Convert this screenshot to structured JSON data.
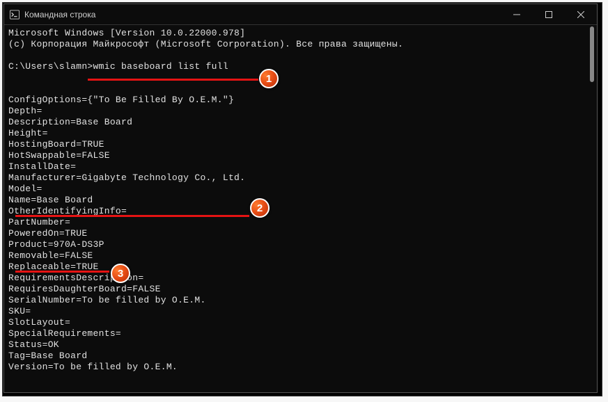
{
  "window": {
    "title": "Командная строка"
  },
  "terminal": {
    "banner_line1": "Microsoft Windows [Version 10.0.22000.978]",
    "banner_line2": "(c) Корпорация Майкрософт (Microsoft Corporation). Все права защищены.",
    "prompt": "C:\\Users\\slamn>",
    "command": "wmic baseboard list full",
    "output": {
      "ConfigOptions": "ConfigOptions={\"To Be Filled By O.E.M.\"}",
      "Depth": "Depth=",
      "Description": "Description=Base Board",
      "Height": "Height=",
      "HostingBoard": "HostingBoard=TRUE",
      "HotSwappable": "HotSwappable=FALSE",
      "InstallDate": "InstallDate=",
      "Manufacturer": "Manufacturer=Gigabyte Technology Co., Ltd.",
      "Model": "Model=",
      "Name": "Name=Base Board",
      "OtherIdentifyingInfo": "OtherIdentifyingInfo=",
      "PartNumber": "PartNumber=",
      "PoweredOn": "PoweredOn=TRUE",
      "Product": "Product=970A-DS3P",
      "Removable": "Removable=FALSE",
      "Replaceable": "Replaceable=TRUE",
      "RequirementsDescription": "RequirementsDescription=",
      "RequiresDaughterBoard": "RequiresDaughterBoard=FALSE",
      "SerialNumber": "SerialNumber=To be filled by O.E.M.",
      "SKU": "SKU=",
      "SlotLayout": "SlotLayout=",
      "SpecialRequirements": "SpecialRequirements=",
      "Status": "Status=OK",
      "Tag": "Tag=Base Board",
      "Version": "Version=To be filled by O.E.M."
    }
  },
  "annotations": {
    "1": "1",
    "2": "2",
    "3": "3"
  }
}
